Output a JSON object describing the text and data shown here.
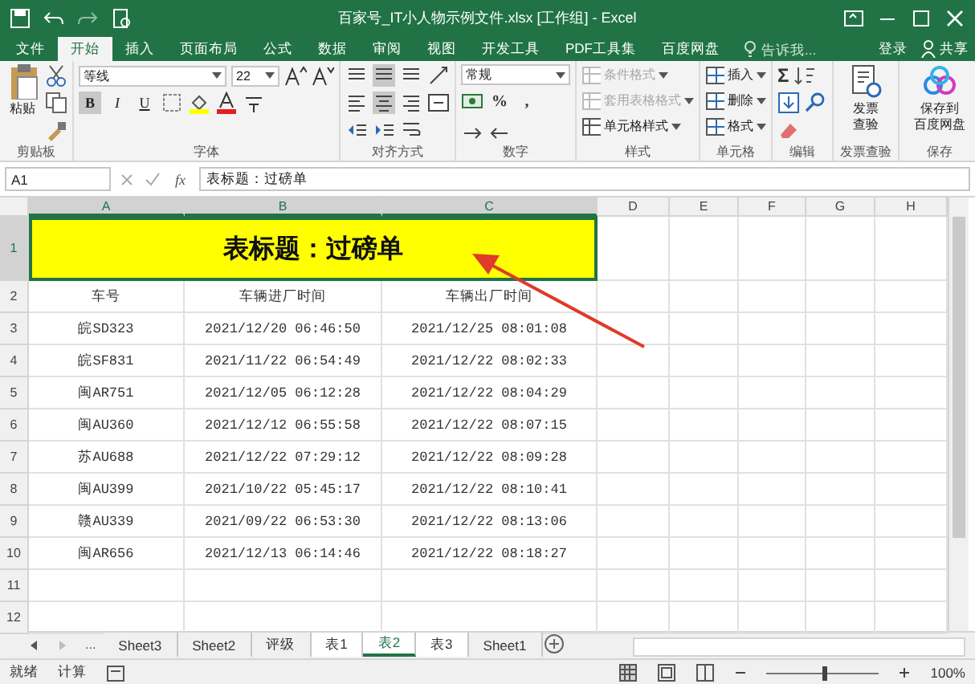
{
  "window": {
    "title": "百家号_IT小人物示例文件.xlsx  [工作组] - Excel"
  },
  "ribbon_tabs": [
    {
      "label": "文件",
      "selected": false
    },
    {
      "label": "开始",
      "selected": true
    },
    {
      "label": "插入",
      "selected": false
    },
    {
      "label": "页面布局",
      "selected": false
    },
    {
      "label": "公式",
      "selected": false
    },
    {
      "label": "数据",
      "selected": false
    },
    {
      "label": "审阅",
      "selected": false
    },
    {
      "label": "视图",
      "selected": false
    },
    {
      "label": "开发工具",
      "selected": false
    },
    {
      "label": "PDF工具集",
      "selected": false
    },
    {
      "label": "百度网盘",
      "selected": false
    }
  ],
  "tell_me": {
    "placeholder": "告诉我..."
  },
  "account": {
    "sign_in": "登录",
    "share": "共享"
  },
  "ribbon_groups": [
    {
      "kind": "clipboard",
      "label": "剪贴板",
      "paste": "粘贴"
    },
    {
      "kind": "font",
      "label": "字体",
      "font": "等线",
      "size": "22",
      "format_buttons": [
        {
          "label": "B",
          "on": true
        },
        {
          "label": "I",
          "on": false
        },
        {
          "label": "U",
          "on": false
        }
      ]
    },
    {
      "kind": "align",
      "label": "对齐方式"
    },
    {
      "kind": "number",
      "label": "数字",
      "format": "常规",
      "symbols": [
        "%",
        ","
      ]
    },
    {
      "kind": "styles",
      "label": "样式",
      "items": [
        {
          "label": "条件格式",
          "disabled": true
        },
        {
          "label": "套用表格格式",
          "disabled": true
        },
        {
          "label": "单元格样式",
          "disabled": false
        }
      ]
    },
    {
      "kind": "cells",
      "label": "单元格",
      "items": [
        {
          "label": "插入"
        },
        {
          "label": "删除"
        },
        {
          "label": "格式"
        }
      ]
    },
    {
      "kind": "editing",
      "label": "编辑",
      "sum": "Σ"
    },
    {
      "kind": "big",
      "label": "发票查验",
      "lines": [
        "发票",
        "查验"
      ]
    },
    {
      "kind": "big",
      "label": "保存",
      "lines": [
        "保存到",
        "百度网盘"
      ]
    }
  ],
  "formula_bar": {
    "name_box": "A1",
    "fx": "fx",
    "content": "表标题：过磅单"
  },
  "sheet": {
    "columns": [
      {
        "label": "A",
        "selected": true
      },
      {
        "label": "B",
        "selected": true
      },
      {
        "label": "C",
        "selected": true
      },
      {
        "label": "D",
        "selected": false
      },
      {
        "label": "E",
        "selected": false
      },
      {
        "label": "F",
        "selected": false
      },
      {
        "label": "G",
        "selected": false
      },
      {
        "label": "H",
        "selected": false
      }
    ],
    "row_numbers": [
      {
        "label": "1",
        "selected": true
      },
      {
        "label": "2",
        "selected": false
      },
      {
        "label": "3",
        "selected": false
      },
      {
        "label": "4",
        "selected": false
      },
      {
        "label": "5",
        "selected": false
      },
      {
        "label": "6",
        "selected": false
      },
      {
        "label": "7",
        "selected": false
      },
      {
        "label": "8",
        "selected": false
      },
      {
        "label": "9",
        "selected": false
      },
      {
        "label": "10",
        "selected": false
      },
      {
        "label": "11",
        "selected": false
      },
      {
        "label": "12",
        "selected": false
      }
    ],
    "title": "表标题：过磅单",
    "header": [
      "车号",
      "车辆进厂时间",
      "车辆出厂时间"
    ],
    "rows": [
      [
        "皖SD323",
        "2021/12/20 06:46:50",
        "2021/12/25 08:01:08"
      ],
      [
        "皖SF831",
        "2021/11/22 06:54:49",
        "2021/12/22 08:02:33"
      ],
      [
        "闽AR751",
        "2021/12/05 06:12:28",
        "2021/12/22 08:04:29"
      ],
      [
        "闽AU360",
        "2021/12/12 06:55:58",
        "2021/12/22 08:07:15"
      ],
      [
        "苏AU688",
        "2021/12/22 07:29:12",
        "2021/12/22 08:09:28"
      ],
      [
        "闽AU399",
        "2021/10/22 05:45:17",
        "2021/12/22 08:10:41"
      ],
      [
        "赣AU339",
        "2021/09/22 06:53:30",
        "2021/12/22 08:13:06"
      ],
      [
        "闽AR656",
        "2021/12/13 06:14:46",
        "2021/12/22 08:18:27"
      ]
    ]
  },
  "sheet_tabs": [
    {
      "label": "Sheet3",
      "selected": false,
      "active": false
    },
    {
      "label": "Sheet2",
      "selected": false,
      "active": false
    },
    {
      "label": "评级",
      "selected": false,
      "active": false
    },
    {
      "label": "表1",
      "selected": true,
      "active": false
    },
    {
      "label": "表2",
      "selected": true,
      "active": true
    },
    {
      "label": "表3",
      "selected": true,
      "active": false
    },
    {
      "label": "Sheet1",
      "selected": false,
      "active": false
    }
  ],
  "sheet_nav": {
    "more": "..."
  },
  "status_bar": {
    "ready": "就绪",
    "calc": "计算",
    "zoom": "100%",
    "zoom_slider": {
      "level": 0.5
    }
  }
}
